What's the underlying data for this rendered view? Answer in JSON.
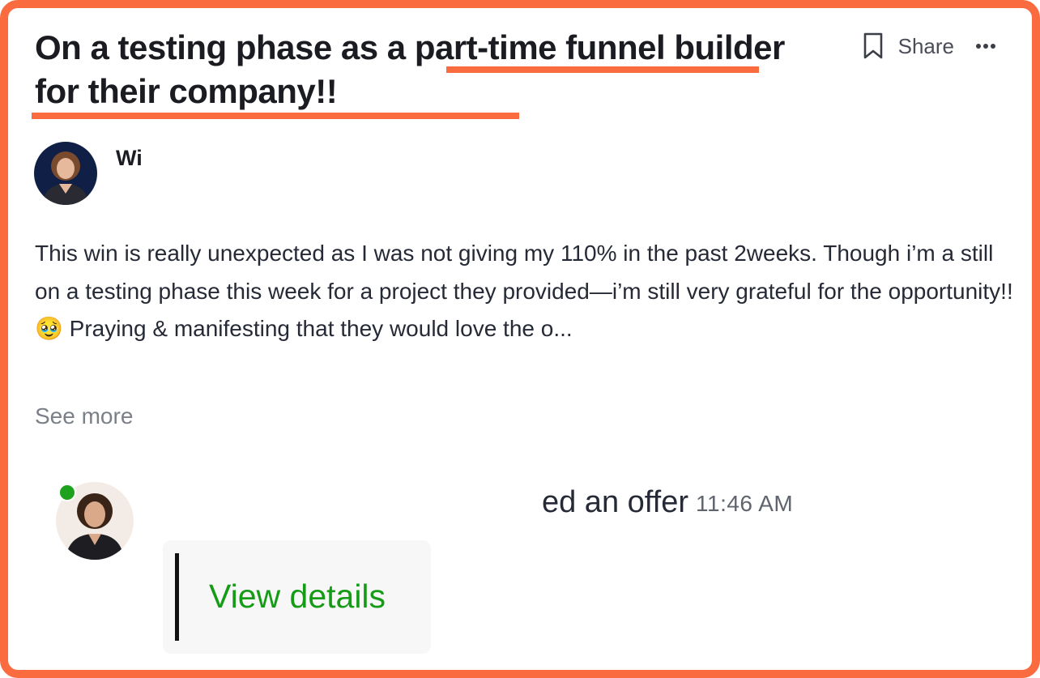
{
  "post": {
    "title": "On a testing phase as a part-time funnel builder for their company!!",
    "author_name": "Wi",
    "body": "This win is really unexpected as I was not giving my 110% in the past 2weeks. Though i’m a still on a testing phase this week for a project they provided—i’m still very grateful for the opportunity!!🥹 Praying & manifesting that they would love the o...",
    "see_more": "See more"
  },
  "actions": {
    "bookmark_icon": "bookmark-icon",
    "share_label": "Share",
    "more_icon": "more-horizontal-icon"
  },
  "offer": {
    "status_text": "ed an offer",
    "time": "11:46 AM",
    "view_details_label": "View details",
    "online_status_color": "#1ea21e"
  },
  "colors": {
    "highlight": "#fa6b3f",
    "title": "#1b1c22",
    "body": "#262a36",
    "link_green": "#169b16"
  }
}
